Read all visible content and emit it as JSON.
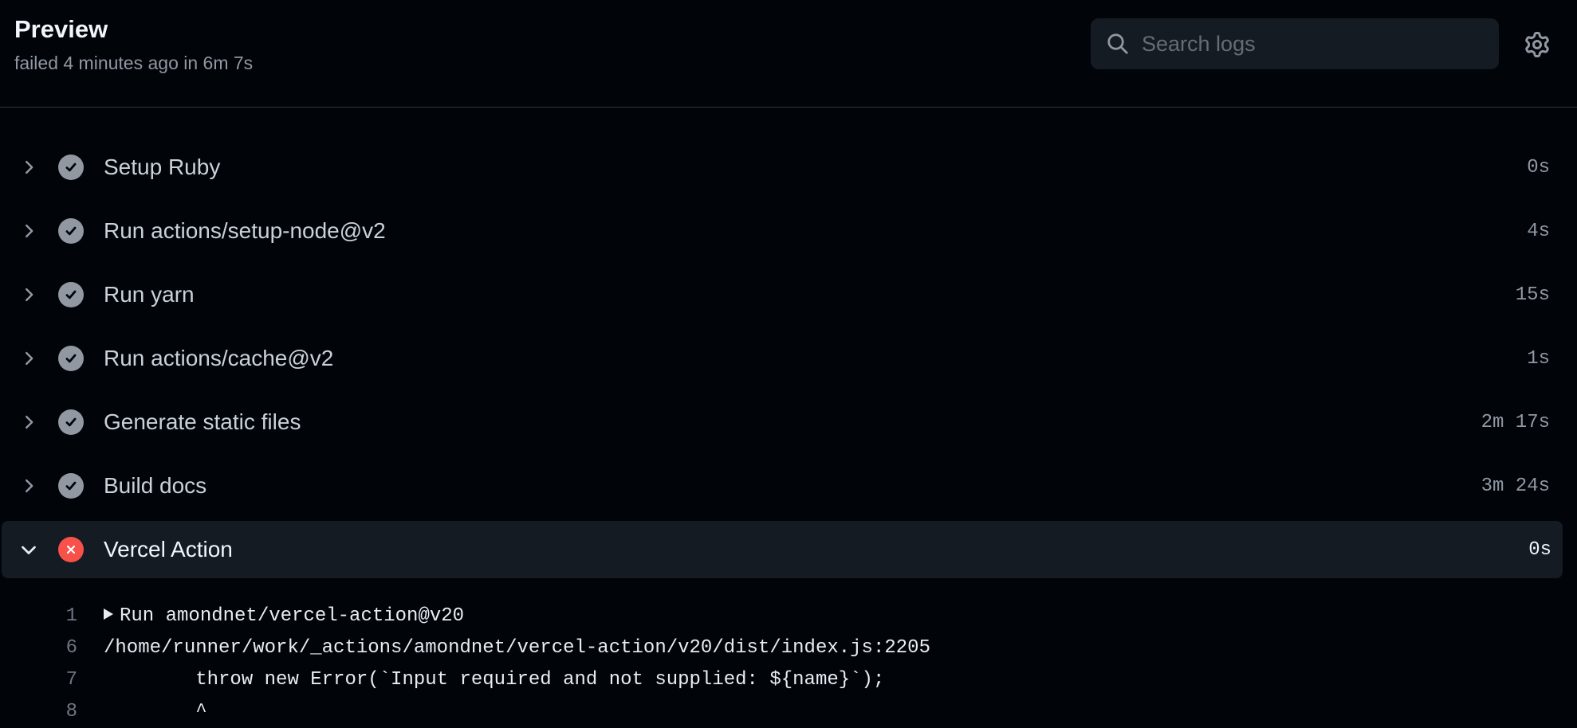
{
  "header": {
    "title": "Preview",
    "subtitle": "failed 4 minutes ago in 6m 7s",
    "search_placeholder": "Search logs",
    "settings_icon": "gear-icon"
  },
  "steps": [
    {
      "name": "Setup Ruby",
      "time": "0s",
      "status": "success",
      "expanded": false
    },
    {
      "name": "Run actions/setup-node@v2",
      "time": "4s",
      "status": "success",
      "expanded": false
    },
    {
      "name": "Run yarn",
      "time": "15s",
      "status": "success",
      "expanded": false
    },
    {
      "name": "Run actions/cache@v2",
      "time": "1s",
      "status": "success",
      "expanded": false
    },
    {
      "name": "Generate static files",
      "time": "2m 17s",
      "status": "success",
      "expanded": false
    },
    {
      "name": "Build docs",
      "time": "3m 24s",
      "status": "success",
      "expanded": false
    },
    {
      "name": "Vercel Action",
      "time": "0s",
      "status": "failure",
      "expanded": true
    }
  ],
  "log": [
    {
      "num": "1",
      "text": "Run amondnet/vercel-action@v20",
      "collapsible": true
    },
    {
      "num": "6",
      "text": "/home/runner/work/_actions/amondnet/vercel-action/v20/dist/index.js:2205",
      "collapsible": false
    },
    {
      "num": "7",
      "text": "        throw new Error(`Input required and not supplied: ${name}`);",
      "collapsible": false
    },
    {
      "num": "8",
      "text": "        ^",
      "collapsible": false
    }
  ],
  "colors": {
    "background": "#010409",
    "success": "#9198a1",
    "failure": "#f85149",
    "active_row": "#151b23"
  }
}
